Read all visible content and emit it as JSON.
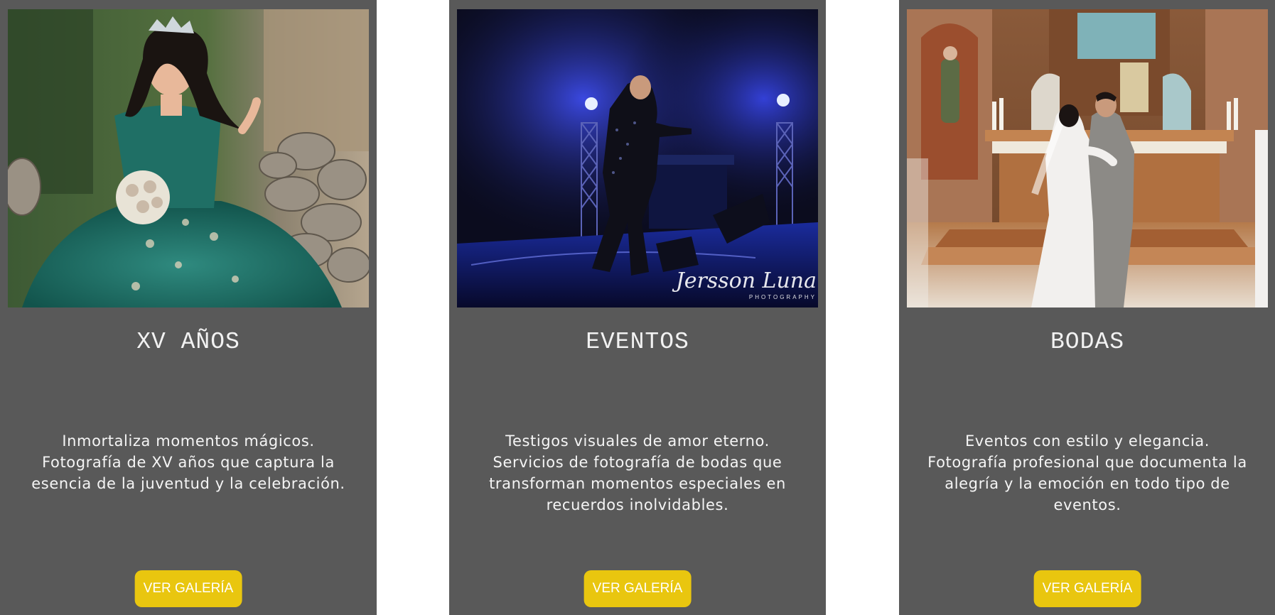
{
  "cards": [
    {
      "title": "XV AÑOS",
      "description": "Inmortaliza momentos mágicos. Fotografía de XV años que captura la esencia de la juventud y la celebración.",
      "button_label": "VER GALERÍA",
      "photo_subject": "quinceañera in teal ball gown beside stone wall"
    },
    {
      "title": "EVENTOS",
      "description": "Testigos visuales de amor eterno. Servicios de fotografía de bodas que transforman momentos especiales en recuerdos inolvidables.",
      "button_label": "VER GALERÍA",
      "photo_subject": "singer performing on stage under blue lights",
      "watermark": "Jersson Luna",
      "watermark_sub": "PHOTOGRAPHY"
    },
    {
      "title": "BODAS",
      "description": "Eventos con estilo y elegancia. Fotografía profesional que documenta la alegría y la emoción en todo tipo de eventos.",
      "button_label": "VER GALERÍA",
      "photo_subject": "bride and groom kissing at church altar"
    }
  ],
  "colors": {
    "card_background": "#595959",
    "button_background": "#e9c60f",
    "text": "#f2f2f2"
  }
}
